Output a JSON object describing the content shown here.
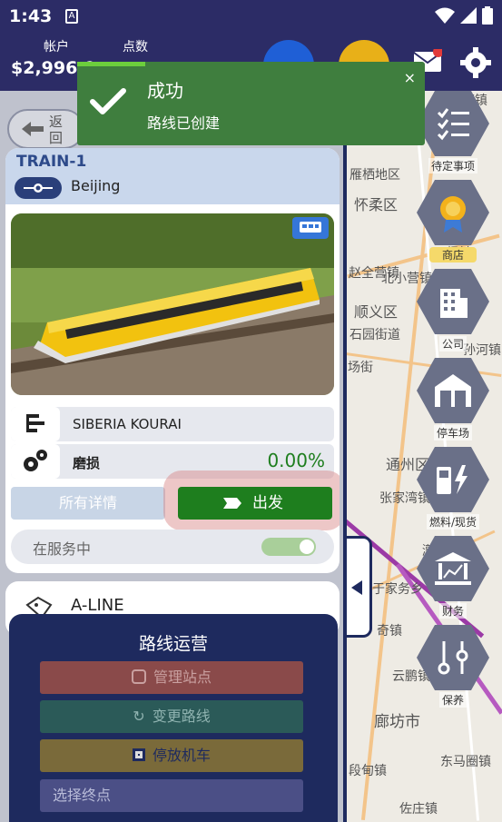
{
  "status_bar": {
    "time": "1:43",
    "a_icon": "A"
  },
  "header": {
    "account_label": "帐户",
    "account_value": "$2,996,9",
    "points_label": "点数"
  },
  "toast": {
    "title": "成功",
    "message": "路线已创建",
    "close": "×"
  },
  "back_button": {
    "label_line1": "返",
    "label_line2": "回"
  },
  "train_card": {
    "name": "TRAIN-1",
    "city": "Beijing",
    "model": "SIBERIA KOURAI",
    "wear_label": "磨损",
    "wear_value": "0.00%",
    "details_button": "所有详情",
    "depart_button": "出发",
    "in_service_label": "在服务中",
    "in_service": true
  },
  "line_card": {
    "name": "A-LINE"
  },
  "route_ops": {
    "title": "路线运营",
    "items": [
      {
        "label": "管理站点",
        "color": "#8a4a4a"
      },
      {
        "label": "变更路线",
        "color": "#2b5a58"
      },
      {
        "label": "停放机车",
        "color": "#7a6a3a"
      },
      {
        "label": "选择终点",
        "color": "#4b4f86"
      }
    ]
  },
  "sidebar": {
    "items": [
      {
        "label": "待定事项",
        "icon": "checklist-icon"
      },
      {
        "label": "商店",
        "icon": "medal-icon"
      },
      {
        "label": "公司",
        "icon": "building-icon"
      },
      {
        "label": "停车场",
        "icon": "depot-icon"
      },
      {
        "label": "燃料/现货",
        "icon": "fuel-icon"
      },
      {
        "label": "财务",
        "icon": "bank-icon"
      },
      {
        "label": "保养",
        "icon": "tools-icon"
      }
    ]
  },
  "map_labels": [
    "漆营镇",
    "雁栖地区",
    "怀柔区",
    "北小营镇",
    "顺义区",
    "石园街道",
    "场街",
    "通州区",
    "张家湾镇",
    "漷县镇",
    "于家务乡",
    "奇镇",
    "云鹏镇",
    "廊坊市",
    "东马圈镇",
    "佐庄镇",
    "段甸镇",
    "杨镇",
    "孙河镇",
    "赵全营镇"
  ],
  "colors": {
    "brand_navy": "#2c2c66",
    "success": "#1e7e1e",
    "toast": "#3f7e3e"
  }
}
